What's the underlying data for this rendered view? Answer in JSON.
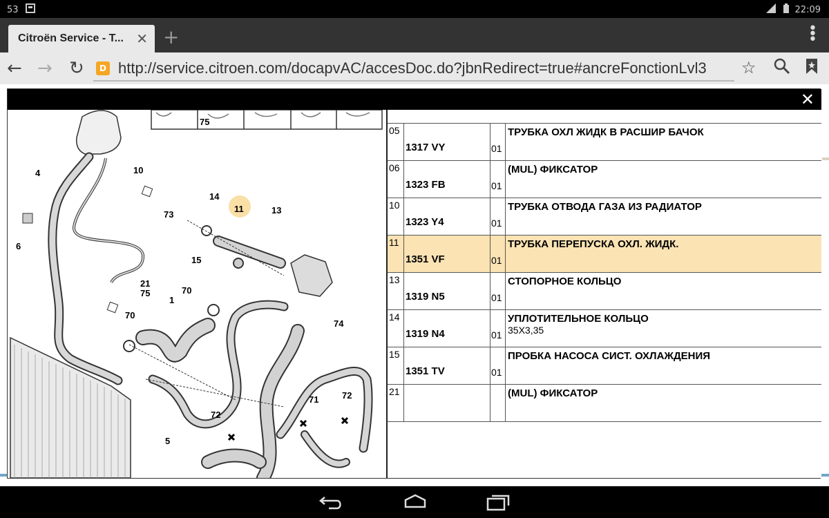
{
  "status": {
    "notification_count": "53",
    "time": "22:09",
    "network": "3G"
  },
  "tab": {
    "title": "Citroën Service - T...",
    "close": "✕"
  },
  "new_tab": "+",
  "nav": {
    "back": "←",
    "forward": "→",
    "reload": "↻"
  },
  "url": "http://service.citroen.com/docapvAC/accesDoc.do?jbnRedirect=true#ancreFonctionLvl3",
  "url_icons": {
    "star": "☆",
    "search": "search-icon",
    "bookmark": "bookmark-icon"
  },
  "modal": {
    "close": "✕"
  },
  "diagram": {
    "labels": [
      "75",
      "10",
      "4",
      "73",
      "14",
      "11",
      "13",
      "6",
      "15",
      "21",
      "75",
      "70",
      "1",
      "70",
      "74",
      "5",
      "72",
      "71",
      "72"
    ]
  },
  "parts": [
    {
      "idx": "05",
      "ref": "1317 VY",
      "qty": "01",
      "name": "ТРУБКА ОХЛ ЖИДК В РАСШИР БАЧОК",
      "sub": "",
      "highlight": false
    },
    {
      "idx": "06",
      "ref": "1323 FB",
      "qty": "01",
      "name": "(MUL) ФИКСАТОР",
      "sub": "",
      "highlight": false
    },
    {
      "idx": "10",
      "ref": "1323 Y4",
      "qty": "01",
      "name": "ТРУБКА ОТВОДА ГАЗА ИЗ РАДИАТОР",
      "sub": "",
      "highlight": false
    },
    {
      "idx": "11",
      "ref": "1351 VF",
      "qty": "01",
      "name": "ТРУБКА ПЕРЕПУСКА ОХЛ. ЖИДК.",
      "sub": "",
      "highlight": true
    },
    {
      "idx": "13",
      "ref": "1319 N5",
      "qty": "01",
      "name": "СТОПОРНОЕ КОЛЬЦО",
      "sub": "",
      "highlight": false
    },
    {
      "idx": "14",
      "ref": "1319 N4",
      "qty": "01",
      "name": "УПЛОТИТЕЛЬНОЕ КОЛЬЦО",
      "sub": "35X3,35",
      "highlight": false
    },
    {
      "idx": "15",
      "ref": "1351 TV",
      "qty": "01",
      "name": "ПРОБКА НАСОСА СИСТ. ОХЛАЖДЕНИЯ",
      "sub": "",
      "highlight": false
    },
    {
      "idx": "21",
      "ref": "",
      "qty": "",
      "name": "(MUL) ФИКСАТОР",
      "sub": "",
      "highlight": false
    }
  ],
  "android_nav": {
    "back": "back-icon",
    "home": "home-icon",
    "recents": "recents-icon"
  },
  "colors": {
    "highlight": "#fbe3b4",
    "tab_bar": "#333333",
    "url_bar": "#e9e9e9",
    "favicon": "#f5a623"
  }
}
